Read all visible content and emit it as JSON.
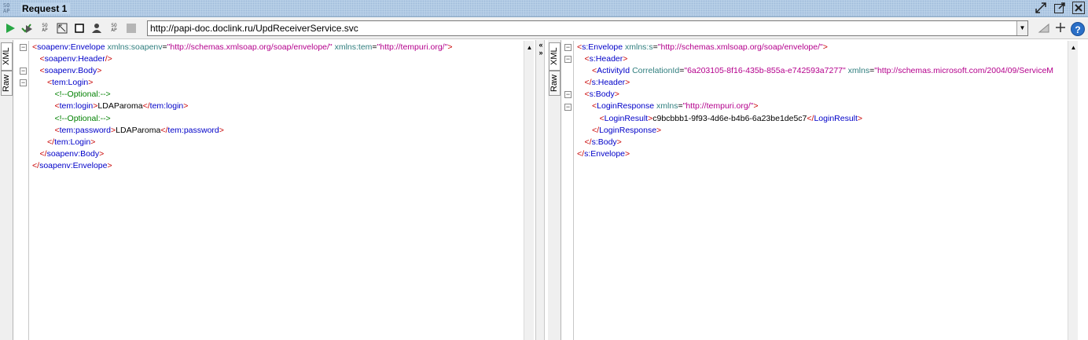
{
  "title_bar": {
    "logo": "SO AP",
    "logo_top": "SO",
    "logo_bottom": "AP",
    "title": "Request 1",
    "icons": [
      "detach-icon",
      "maximize-icon",
      "close-icon"
    ]
  },
  "toolbar": {
    "icons": [
      "run-icon",
      "validate-icon",
      "soap-icon",
      "expand-icon",
      "square-icon",
      "user-icon",
      "soap-icon",
      "stop-icon"
    ],
    "url": "http://papi-doc.doclink.ru/UpdReceiverService.svc",
    "right_icons": [
      "settings-icon",
      "add-icon",
      "help-icon"
    ]
  },
  "request_panel": {
    "tabs": [
      "XML",
      "Raw"
    ],
    "lines": [
      {
        "indent": 0,
        "parts": [
          [
            "br",
            "<"
          ],
          [
            "tg",
            "soapenv:Envelope"
          ],
          [
            "tx",
            " "
          ],
          [
            "at",
            "xmlns:soapenv"
          ],
          [
            "tx",
            "="
          ],
          [
            "av",
            "\"http://schemas.xmlsoap.org/soap/envelope/\""
          ],
          [
            "tx",
            " "
          ],
          [
            "at",
            "xmlns:tem"
          ],
          [
            "tx",
            "="
          ],
          [
            "av",
            "\"http://tempuri.org/\""
          ],
          [
            "br",
            ">"
          ]
        ],
        "fold": true
      },
      {
        "indent": 1,
        "parts": [
          [
            "br",
            "<"
          ],
          [
            "tg",
            "soapenv:Header"
          ],
          [
            "br",
            "/>"
          ]
        ],
        "fold": false
      },
      {
        "indent": 1,
        "parts": [
          [
            "br",
            "<"
          ],
          [
            "tg",
            "soapenv:Body"
          ],
          [
            "br",
            ">"
          ]
        ],
        "fold": true
      },
      {
        "indent": 2,
        "parts": [
          [
            "br",
            "<"
          ],
          [
            "tg",
            "tem:Login"
          ],
          [
            "br",
            ">"
          ]
        ],
        "fold": true
      },
      {
        "indent": 3,
        "parts": [
          [
            "cm",
            "<!--Optional:-->"
          ]
        ],
        "fold": false
      },
      {
        "indent": 3,
        "parts": [
          [
            "br",
            "<"
          ],
          [
            "tg",
            "tem:login"
          ],
          [
            "br",
            ">"
          ],
          [
            "tx",
            "LDAParoma"
          ],
          [
            "br",
            "</"
          ],
          [
            "tg",
            "tem:login"
          ],
          [
            "br",
            ">"
          ]
        ],
        "fold": false
      },
      {
        "indent": 3,
        "parts": [
          [
            "cm",
            "<!--Optional:-->"
          ]
        ],
        "fold": false
      },
      {
        "indent": 3,
        "parts": [
          [
            "br",
            "<"
          ],
          [
            "tg",
            "tem:password"
          ],
          [
            "br",
            ">"
          ],
          [
            "tx",
            "LDAParoma"
          ],
          [
            "br",
            "</"
          ],
          [
            "tg",
            "tem:password"
          ],
          [
            "br",
            ">"
          ]
        ],
        "fold": false
      },
      {
        "indent": 2,
        "parts": [
          [
            "br",
            "</"
          ],
          [
            "tg",
            "tem:Login"
          ],
          [
            "br",
            ">"
          ]
        ],
        "fold": false
      },
      {
        "indent": 1,
        "parts": [
          [
            "br",
            "</"
          ],
          [
            "tg",
            "soapenv:Body"
          ],
          [
            "br",
            ">"
          ]
        ],
        "fold": false
      },
      {
        "indent": 0,
        "parts": [
          [
            "br",
            "</"
          ],
          [
            "tg",
            "soapenv:Envelope"
          ],
          [
            "br",
            ">"
          ]
        ],
        "fold": false
      }
    ]
  },
  "response_panel": {
    "tabs": [
      "XML",
      "Raw"
    ],
    "lines": [
      {
        "indent": 0,
        "parts": [
          [
            "br",
            "<"
          ],
          [
            "tg",
            "s:Envelope"
          ],
          [
            "tx",
            " "
          ],
          [
            "at",
            "xmlns:s"
          ],
          [
            "tx",
            "="
          ],
          [
            "av",
            "\"http://schemas.xmlsoap.org/soap/envelope/\""
          ],
          [
            "br",
            ">"
          ]
        ],
        "fold": true
      },
      {
        "indent": 1,
        "parts": [
          [
            "br",
            "<"
          ],
          [
            "tg",
            "s:Header"
          ],
          [
            "br",
            ">"
          ]
        ],
        "fold": true
      },
      {
        "indent": 2,
        "parts": [
          [
            "br",
            "<"
          ],
          [
            "tg",
            "ActivityId"
          ],
          [
            "tx",
            " "
          ],
          [
            "at",
            "CorrelationId"
          ],
          [
            "tx",
            "="
          ],
          [
            "av",
            "\"6a203105-8f16-435b-855a-e742593a7277\""
          ],
          [
            "tx",
            " "
          ],
          [
            "at",
            "xmlns"
          ],
          [
            "tx",
            "="
          ],
          [
            "av",
            "\"http://schemas.microsoft.com/2004/09/ServiceM"
          ]
        ],
        "fold": false
      },
      {
        "indent": 1,
        "parts": [
          [
            "br",
            "</"
          ],
          [
            "tg",
            "s:Header"
          ],
          [
            "br",
            ">"
          ]
        ],
        "fold": false
      },
      {
        "indent": 1,
        "parts": [
          [
            "br",
            "<"
          ],
          [
            "tg",
            "s:Body"
          ],
          [
            "br",
            ">"
          ]
        ],
        "fold": true
      },
      {
        "indent": 2,
        "parts": [
          [
            "br",
            "<"
          ],
          [
            "tg",
            "LoginResponse"
          ],
          [
            "tx",
            " "
          ],
          [
            "at",
            "xmlns"
          ],
          [
            "tx",
            "="
          ],
          [
            "av",
            "\"http://tempuri.org/\""
          ],
          [
            "br",
            ">"
          ]
        ],
        "fold": true
      },
      {
        "indent": 3,
        "parts": [
          [
            "br",
            "<"
          ],
          [
            "tg",
            "LoginResult"
          ],
          [
            "br",
            ">"
          ],
          [
            "tx",
            "c9bcbbb1-9f93-4d6e-b4b6-6a23be1de5c7"
          ],
          [
            "br",
            "</"
          ],
          [
            "tg",
            "LoginResult"
          ],
          [
            "br",
            ">"
          ]
        ],
        "fold": false
      },
      {
        "indent": 2,
        "parts": [
          [
            "br",
            "</"
          ],
          [
            "tg",
            "LoginResponse"
          ],
          [
            "br",
            ">"
          ]
        ],
        "fold": false
      },
      {
        "indent": 1,
        "parts": [
          [
            "br",
            "</"
          ],
          [
            "tg",
            "s:Body"
          ],
          [
            "br",
            ">"
          ]
        ],
        "fold": false
      },
      {
        "indent": 0,
        "parts": [
          [
            "br",
            "</"
          ],
          [
            "tg",
            "s:Envelope"
          ],
          [
            "br",
            ">"
          ]
        ],
        "fold": false
      }
    ]
  }
}
